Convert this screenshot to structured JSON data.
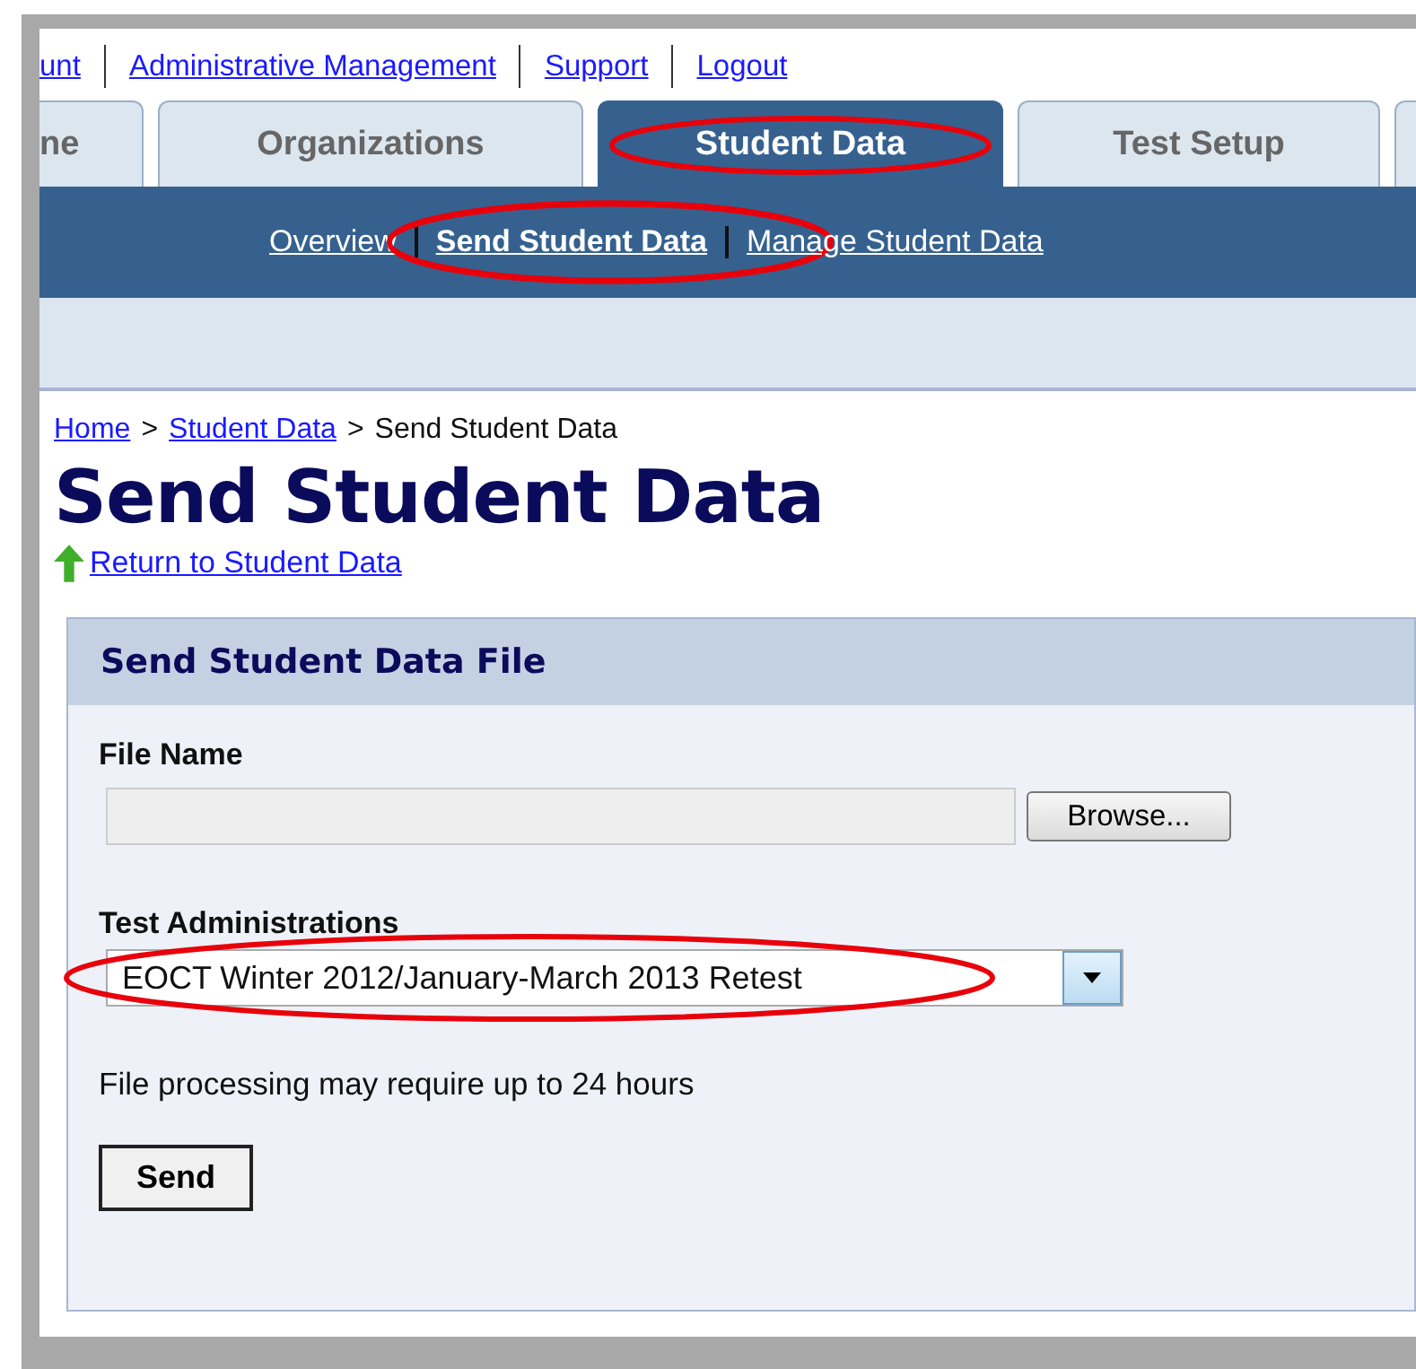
{
  "top_links": [
    "unt",
    "Administrative Management",
    "Support",
    "Logout"
  ],
  "tabs": [
    {
      "label": "ne",
      "selected": false,
      "highlighted": false
    },
    {
      "label": "Organizations",
      "selected": false,
      "highlighted": false
    },
    {
      "label": "Student Data",
      "selected": true,
      "highlighted": true
    },
    {
      "label": "Test Setup",
      "selected": false,
      "highlighted": false
    }
  ],
  "subnav": [
    {
      "label": "Overview",
      "selected": false,
      "highlighted": false
    },
    {
      "label": "Send Student Data",
      "selected": true,
      "highlighted": true
    },
    {
      "label": "Manage Student Data",
      "selected": false,
      "highlighted": false
    }
  ],
  "breadcrumb": {
    "links": [
      {
        "label": "Home",
        "separator": ">"
      },
      {
        "label": "Student Data",
        "separator": ">"
      }
    ],
    "current": "Send Student Data"
  },
  "page_title": "Send Student Data",
  "return_link": "Return to Student Data",
  "panel": {
    "title": "Send Student Data File",
    "file_label": "File Name",
    "browse_button": "Browse...",
    "select_label": "Test Administrations",
    "select": {
      "value": "EOCT Winter 2012/January-March 2013 Retest",
      "highlighted": true
    },
    "note": "File processing may require up to 24 hours",
    "send_button": "Send"
  }
}
